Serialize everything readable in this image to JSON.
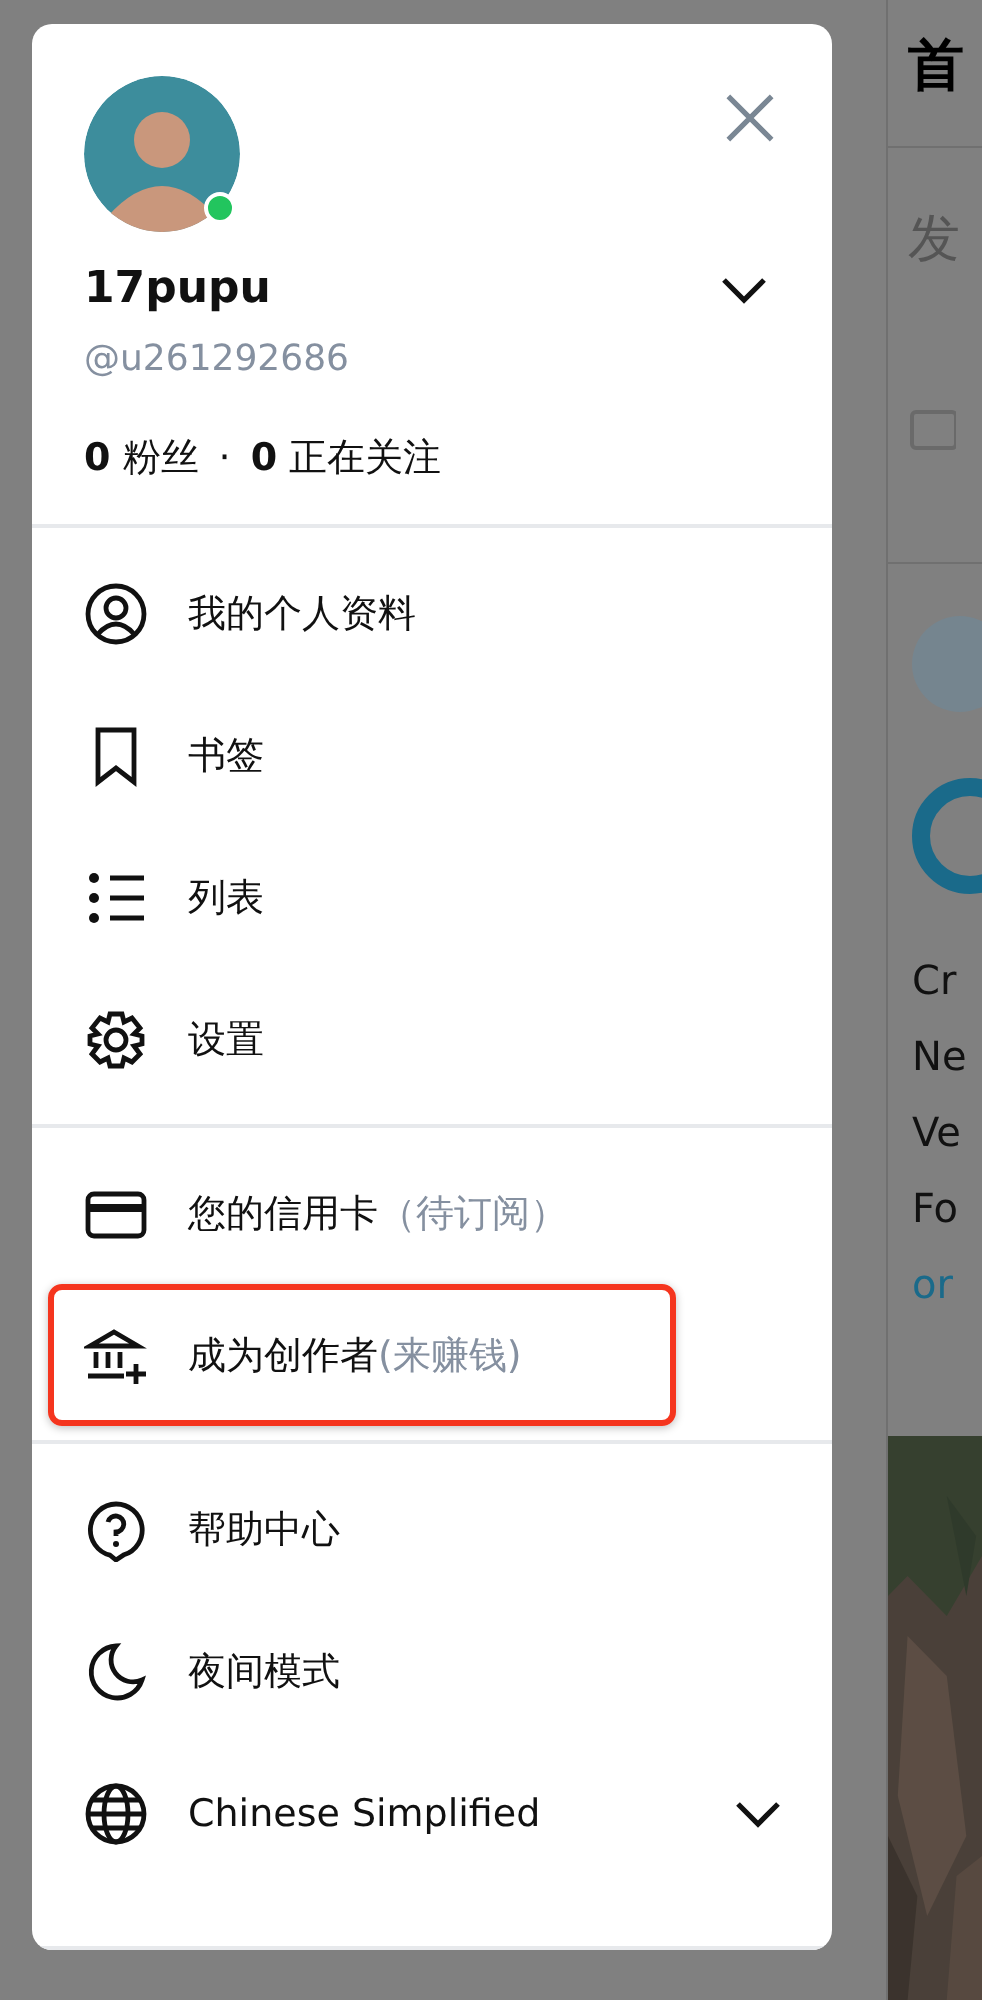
{
  "background": {
    "header_title": "首",
    "compose_placeholder": "发",
    "post_lines": [
      "Cr",
      "Ne",
      "Ve",
      "Fo"
    ],
    "post_link": "or"
  },
  "drawer": {
    "profile": {
      "name": "17pupu",
      "handle": "@u261292686",
      "online": true,
      "stats": [
        {
          "count": "0",
          "label": "粉丝"
        },
        {
          "count": "0",
          "label": "正在关注"
        }
      ],
      "separator": "·"
    },
    "sections": [
      [
        {
          "label": "我的个人资料",
          "kind": "link",
          "highlighted": false
        },
        {
          "label": "书签",
          "kind": "link",
          "highlighted": false
        },
        {
          "label": "列表",
          "kind": "link",
          "highlighted": false
        },
        {
          "label": "设置",
          "kind": "link",
          "highlighted": false
        }
      ],
      [
        {
          "label": "您的信用卡",
          "note": "（待订阅）",
          "kind": "link",
          "highlighted": false
        },
        {
          "label": "成为创作者",
          "note": "(来赚钱)",
          "kind": "link",
          "highlighted": true
        }
      ],
      [
        {
          "label": "帮助中心",
          "kind": "link",
          "highlighted": false
        },
        {
          "label": "夜间模式",
          "kind": "link",
          "highlighted": false
        },
        {
          "label": "Chinese Simplified",
          "kind": "dropdown",
          "highlighted": false
        }
      ]
    ]
  }
}
